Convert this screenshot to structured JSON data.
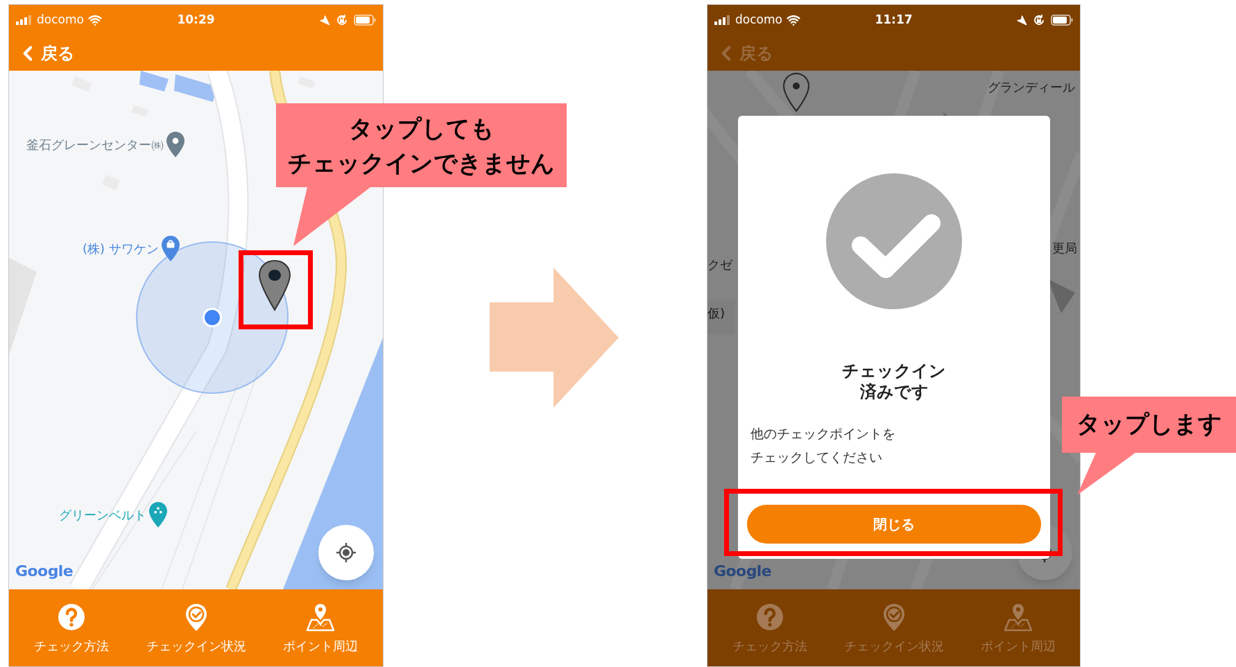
{
  "screens": [
    {
      "dimmed": false,
      "status_bar": {
        "carrier": "docomo",
        "time": "10:29"
      },
      "nav": {
        "back_label": "戻る"
      },
      "map": {
        "labels": [
          {
            "text": "釜石グレーンセンター㈱",
            "kind": "place",
            "color": "#6b7f8c"
          },
          {
            "text": "(株) サワケン",
            "kind": "shop",
            "color": "#4a88e0"
          },
          {
            "text": "グリーンベルト",
            "kind": "service",
            "color": "#1aa7b8"
          }
        ],
        "attribution": "Google"
      },
      "tabs": [
        {
          "label": "チェック方法",
          "kind": "help"
        },
        {
          "label": "チェックイン状況",
          "kind": "checkin"
        },
        {
          "label": "ポイント周辺",
          "kind": "map"
        }
      ]
    },
    {
      "dimmed": true,
      "status_bar": {
        "carrier": "docomo",
        "time": "11:17"
      },
      "nav": {
        "back_label": "戻る"
      },
      "map": {
        "labels": [
          {
            "text": "グランディール",
            "kind": "text",
            "color": "#3a3a3a"
          },
          {
            "text": "更局",
            "kind": "text",
            "color": "#3a3a3a"
          },
          {
            "text": "クゼ",
            "kind": "text",
            "color": "#3a3a3a"
          },
          {
            "text": "仮)",
            "kind": "text",
            "color": "#2a2a2a"
          }
        ],
        "attribution": "Google"
      },
      "dialog": {
        "title_lines": [
          "チェックイン",
          "済みです"
        ],
        "message_lines": [
          "他のチェックポイントを",
          "チェックしてください"
        ],
        "button": "閉じる"
      },
      "tabs": [
        {
          "label": "チェック方法",
          "kind": "help"
        },
        {
          "label": "チェックイン状況",
          "kind": "checkin"
        },
        {
          "label": "ポイント周辺",
          "kind": "map"
        }
      ]
    }
  ],
  "callouts": [
    {
      "lines": [
        "タップしても",
        "チェックインできません"
      ]
    },
    {
      "lines": [
        "タップします"
      ]
    }
  ]
}
